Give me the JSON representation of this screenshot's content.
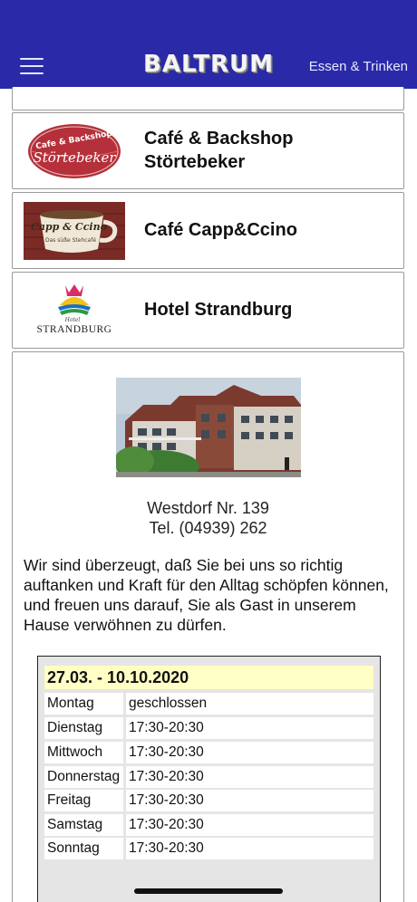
{
  "header": {
    "brand": "BALTRUM",
    "nav_right": "Essen & Trinken"
  },
  "list": [
    {
      "name": "Café & Backshop\nStörtebeker",
      "logo_top": "Cafe & Backshop",
      "logo_main": "Störtebeker"
    },
    {
      "name": "Café Capp&Ccino",
      "logo_top": "Capp & Ccino",
      "logo_sub": "Das süße Stehcafé"
    },
    {
      "name": "Hotel Strandburg",
      "logo_top": "Hotel",
      "logo_main": "STRANDBURG"
    }
  ],
  "detail": {
    "address": "Westdorf Nr. 139",
    "phone": "Tel. (04939) 262",
    "description": "Wir sind überzeugt, daß Sie bei uns so richtig auftanken und Kraft für den Alltag schöpfen können, und freuen uns darauf, Sie als Gast in unserem Hause verwöhnen zu dürfen.",
    "season": "27.03. - 10.10.2020",
    "hours": [
      {
        "day": "Montag",
        "time": "geschlossen"
      },
      {
        "day": "Dienstag",
        "time": "17:30-20:30"
      },
      {
        "day": "Mittwoch",
        "time": "17:30-20:30"
      },
      {
        "day": "Donnerstag",
        "time": "17:30-20:30"
      },
      {
        "day": "Freitag",
        "time": "17:30-20:30"
      },
      {
        "day": "Samstag",
        "time": "17:30-20:30"
      },
      {
        "day": "Sonntag",
        "time": "17:30-20:30"
      }
    ]
  },
  "colors": {
    "header_bg": "#2a2aa8",
    "season_bg": "#ffffc6",
    "hours_bg": "#e5e5e5"
  }
}
